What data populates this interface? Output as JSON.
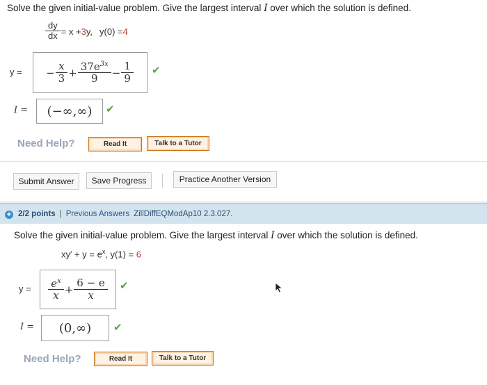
{
  "problem1": {
    "instruction_a": "Solve the given initial-value problem. Give the largest interval ",
    "interval_var": "I",
    "instruction_b": " over which the solution is defined.",
    "de_num": "dy",
    "de_den": "dx",
    "de_rhs_a": "= x + ",
    "de_rhs_coef": "3",
    "de_rhs_b": "y,",
    "ic_label": "y(0) = ",
    "ic_value": "4",
    "y_label": "y =",
    "sol_t1_sign": "−",
    "sol_t1_num": "x",
    "sol_t1_den": "3",
    "sol_op1": "+",
    "sol_t2_num": "37e",
    "sol_t2_exp": "3x",
    "sol_t2_den": "9",
    "sol_op2": "−",
    "sol_t3_num": "1",
    "sol_t3_den": "9",
    "i_label": "I =",
    "interval": "(−∞,∞)",
    "need_help": "Need Help?",
    "read_it": "Read It",
    "talk_to_tutor": "Talk to a Tutor"
  },
  "actions": {
    "submit": "Submit Answer",
    "save": "Save Progress",
    "practice": "Practice Another Version"
  },
  "problem2_header": {
    "points": "2/2 points",
    "separator": "|",
    "previous_answers": "Previous Answers",
    "problem_id": "ZillDiffEQModAp10 2.3.027."
  },
  "problem2": {
    "instruction_a": "Solve the given initial-value problem. Give the largest interval ",
    "interval_var": "I",
    "instruction_b": " over which the solution is defined.",
    "de_lhs": "xy′ + y = e",
    "de_exp": "x",
    "ic_label": ",  y(1) = ",
    "ic_value": "6",
    "y_label": "y =",
    "t1_num": "e",
    "t1_exp": "x",
    "t1_den": "x",
    "op": "+",
    "t2_num": "6 − e",
    "t2_den": "x",
    "i_label": "I =",
    "interval": "(0,∞)",
    "need_help": "Need Help?",
    "read_it": "Read It",
    "talk_to_tutor": "Talk to a Tutor"
  },
  "colors": {
    "check": "#5aa637",
    "header_bg": "#d4e4ef",
    "accent_red": "#c0392b"
  }
}
